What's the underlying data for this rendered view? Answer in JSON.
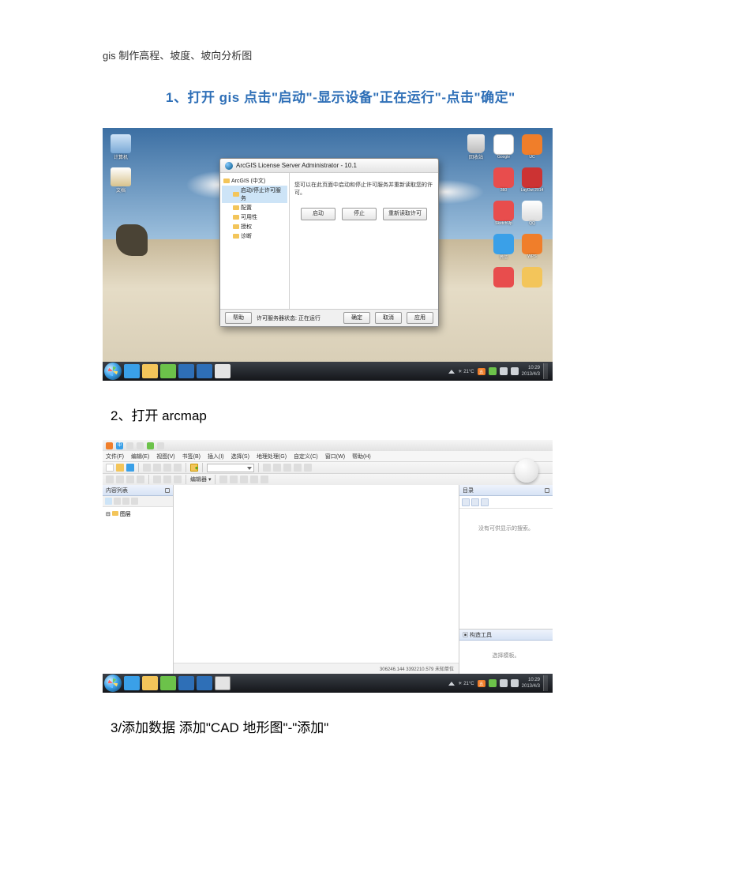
{
  "document": {
    "title": "gis 制作高程、坡度、坡向分析图",
    "step1": "1、打开 gis    点击\"启动\"-显示设备\"正在运行\"-点击\"确定\"",
    "step2": "2、打开 arcmap",
    "step3": "3/添加数据    添加\"CAD 地形图\"-\"添加\""
  },
  "shot1": {
    "dialog": {
      "title": "ArcGIS License Server Administrator - 10.1",
      "tree": {
        "root": "ArcGIS (中文)",
        "children": [
          "启动/停止许可服务",
          "配置",
          "可用性",
          "授权",
          "诊断"
        ]
      },
      "message": "您可以在此页面中启动和停止许可服务并重新读取您的许可。",
      "buttons": {
        "start": "启动",
        "stop": "停止",
        "reread": "重新读取许可"
      },
      "footer": {
        "help": "帮助",
        "status": "许可服务器状态: 正在运行",
        "ok": "确定",
        "cancel": "取消",
        "apply": "应用"
      }
    },
    "desktop": {
      "left_icons": [
        "计算机",
        "文档",
        "回收站"
      ],
      "trash": "回收站",
      "right_icons": [
        "Google",
        "UC",
        "360",
        "LayOut 2014",
        "SketchUp",
        "QQ",
        "微信",
        "WPS"
      ]
    },
    "taskbar": {
      "clock_time": "10:29",
      "clock_date": "2013/4/3",
      "input_indicator": "五"
    }
  },
  "shot2": {
    "title_icons": [
      "sogou",
      "zh",
      "fullwidth",
      "soft-keyboard",
      "skin",
      "menu"
    ],
    "menus": [
      "文件(F)",
      "编辑(E)",
      "视图(V)",
      "书签(B)",
      "插入(I)",
      "选择(S)",
      "地理处理(G)",
      "自定义(C)",
      "窗口(W)",
      "帮助(H)"
    ],
    "toolbar2_label": "编辑器 ▾",
    "toc": {
      "header": "内容列表",
      "root": "图层"
    },
    "catalog": {
      "header": "目录",
      "empty": "没有可供显示的搜索。"
    },
    "geotool": {
      "header": "构造工具",
      "empty": "选择模板。"
    },
    "status": "306246.144 3392210.579 未知单位",
    "taskbar": {
      "clock_time": "10:29",
      "clock_date": "2013/4/3",
      "input_indicator": "五"
    }
  },
  "colors": {
    "accent": "#2e6fb7",
    "orange": "#f07e2a",
    "green": "#6cc24a",
    "blue": "#3aa0e8",
    "red": "#e84d4d",
    "yellow": "#f3c55a"
  }
}
